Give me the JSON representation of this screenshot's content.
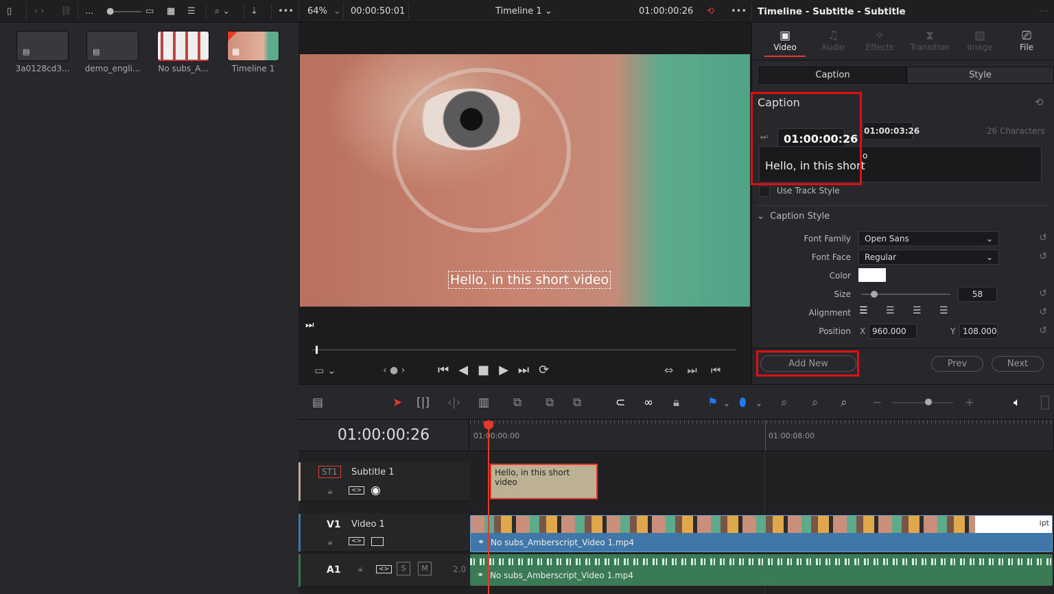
{
  "topbar": {
    "pool_more": "...",
    "zoom": "64%",
    "source_timecode": "00:00:50:01",
    "timeline_name": "Timeline 1",
    "record_timecode": "01:00:00:26",
    "inspector_title": "Timeline - Subtitle - Subtitle"
  },
  "media_pool": {
    "clips": [
      {
        "name": "3a0128cd3..."
      },
      {
        "name": "demo_engli..."
      },
      {
        "name": "No subs_A..."
      },
      {
        "name": "Timeline 1"
      }
    ]
  },
  "viewer": {
    "subtitle_overlay": "Hello, in this short video"
  },
  "inspector": {
    "tabs": [
      {
        "label": "Video",
        "active": true
      },
      {
        "label": "Audio"
      },
      {
        "label": "Effects"
      },
      {
        "label": "Transition"
      },
      {
        "label": "Image"
      },
      {
        "label": "File"
      }
    ],
    "subtabs": [
      {
        "label": "Caption",
        "active": true
      },
      {
        "label": "Style"
      }
    ],
    "caption": {
      "heading": "Caption",
      "start": "01:00:00:26",
      "duration": "01:00:03:26",
      "char_count": "26 Characters",
      "text": "Hello, in this short",
      "text_overflow": "o",
      "use_track_style": "Use Track Style",
      "use_track_style_checked": false
    },
    "caption_style": {
      "heading": "Caption Style",
      "font_family_label": "Font Family",
      "font_family": "Open Sans",
      "font_face_label": "Font Face",
      "font_face": "Regular",
      "color_label": "Color",
      "color": "#ffffff",
      "size_label": "Size",
      "size": "58",
      "size_slider_fraction": 0.15,
      "alignment_label": "Alignment",
      "position_label": "Position",
      "x_label": "X",
      "x": "960.000",
      "y_label": "Y",
      "y": "108.000"
    },
    "add_new": "Add New",
    "prev": "Prev",
    "next": "Next"
  },
  "timeline": {
    "timecode": "01:00:00:26",
    "ruler": [
      "01:00:00:00",
      "01:00:08:00"
    ],
    "tracks": [
      {
        "id": "ST1",
        "name": "Subtitle 1",
        "clip": "Hello, in this short video"
      },
      {
        "id": "V1",
        "name": "Video 1",
        "clip": "No subs_Amberscript_Video 1.mp4",
        "end_text": "ipt"
      },
      {
        "id": "A1",
        "clip": "No subs_Amberscript_Video 1.mp4",
        "solo": "S",
        "mute": "M",
        "channels": "2.0"
      }
    ]
  },
  "colors": {
    "accent_red": "#e53b2c",
    "highlight": "#e01010",
    "video_clip": "#3f77a8",
    "audio_clip": "#3a7a55",
    "subtitle_clip": "#bcb195"
  }
}
